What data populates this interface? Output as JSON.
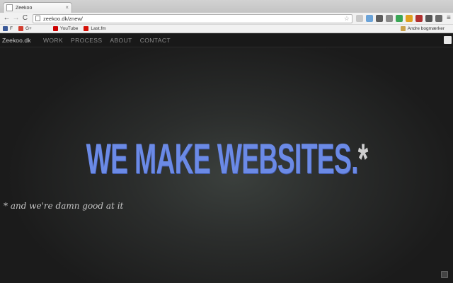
{
  "browser": {
    "tab_title": "Zeekoo",
    "tab_close": "×",
    "url": "zeekoo.dk/znew/",
    "back": "←",
    "forward": "→",
    "reload": "C",
    "star": "☆",
    "menu": "≡"
  },
  "bookmarks": {
    "items": [
      {
        "label": "F",
        "icon": "facebook-icon"
      },
      {
        "label": "G+",
        "icon": "google-plus-icon"
      },
      {
        "label": "YouTube",
        "icon": "youtube-icon"
      },
      {
        "label": "Last.fm",
        "icon": "lastfm-icon"
      }
    ],
    "other": "Andre bogmærker"
  },
  "site": {
    "logo": "Zeekoo.dk",
    "nav": [
      "WORK",
      "PROCESS",
      "ABOUT",
      "CONTACT"
    ],
    "headline": "WE MAKE WEBSITES.",
    "headline_star": "*",
    "tagline": "* and we're damn good at it",
    "colors": {
      "headline": "#6b8ae6",
      "background": "#2b2d2c",
      "navbar": "#191919"
    }
  }
}
